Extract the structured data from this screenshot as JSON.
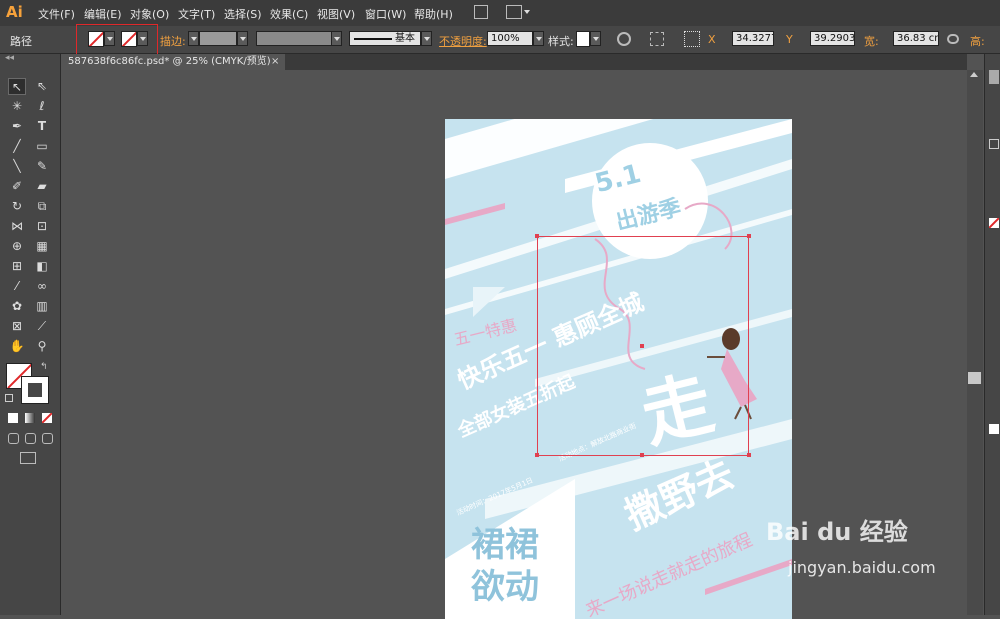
{
  "app": {
    "logo": "Ai"
  },
  "menubar": {
    "items": [
      "文件(F)",
      "编辑(E)",
      "对象(O)",
      "文字(T)",
      "选择(S)",
      "效果(C)",
      "视图(V)",
      "窗口(W)",
      "帮助(H)"
    ]
  },
  "controlbar": {
    "object_type": "路径",
    "stroke_label": "描边:",
    "brush_label": "基本",
    "opacity_label": "不透明度:",
    "opacity_value": "100%",
    "style_label": "样式:",
    "x_label": "X",
    "x_value": "34.3277",
    "y_label": "Y",
    "y_value": "39.2903",
    "w_label": "宽:",
    "w_value": "36.83 cm",
    "h_label": "高:"
  },
  "document_tab": {
    "title": "587638f6c86fc.psd* @ 25% (CMYK/预览)"
  },
  "poster": {
    "date_badge": "5.1",
    "season": "出游季",
    "promo_small": "五一特惠",
    "slogan1": "快乐五一 惠顾全城",
    "slogan2": "全部女装五折起",
    "big_char": "走",
    "sub_big": "撒野去",
    "travel": "TRAVEL",
    "skirt_line1": "裙裙",
    "skirt_line2": "欲动",
    "tagline": "来一场说走就走的旅程",
    "event_info": "活动时间：2017年5月1日",
    "event_place": "活动地点：解放北路商业街"
  },
  "watermark": {
    "brand": "Bai du 经验",
    "url": "jingyan.baidu.com"
  },
  "colors": {
    "accent": "#f7a23b",
    "selection": "#e04050",
    "poster_bg": "#c6e3ef",
    "pink": "#e7a9c7"
  }
}
